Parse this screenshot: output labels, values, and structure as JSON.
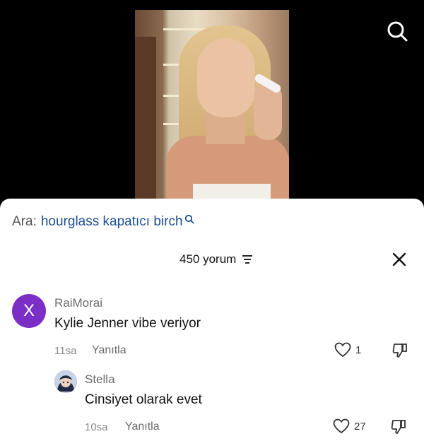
{
  "video": {
    "search_icon": "search-icon"
  },
  "comments_panel": {
    "search_prefix": "Ara:",
    "search_query": "hourglass kapatıcı birch",
    "comment_count": "450 yorum",
    "sort_icon": "sort-icon",
    "close_icon": "close-icon"
  },
  "comments": [
    {
      "avatar_letter": "X",
      "avatar_color": "#7b2fc7",
      "username": "RaiMorai",
      "text": "Kylie Jenner vibe veriyor",
      "time": "11sa",
      "reply_label": "Yanıtla",
      "likes": "1"
    },
    {
      "username": "Stella",
      "text": "Cinsiyet olarak evet",
      "time": "10sa",
      "reply_label": "Yanıtla",
      "likes": "27"
    }
  ]
}
